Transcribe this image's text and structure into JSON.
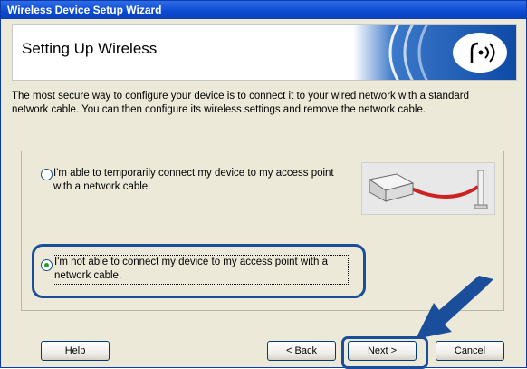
{
  "window": {
    "title": "Wireless Device Setup Wizard"
  },
  "header": {
    "title": "Setting Up Wireless",
    "logo_icon": "wireless-signal-icon"
  },
  "description": "The most secure way to configure your device is to connect it to your wired network with a standard network cable. You can then configure its wireless settings and remove the network cable.",
  "options": [
    {
      "label": "I'm able to temporarily connect my device to my access point with a network cable.",
      "selected": false
    },
    {
      "label": "I'm not able to connect my device to my access point with a network cable.",
      "selected": true
    }
  ],
  "illustration_icon": "printer-cable-accesspoint-icon",
  "buttons": {
    "help": "Help",
    "back": "< Back",
    "next": "Next >",
    "cancel": "Cancel"
  },
  "colors": {
    "titlebar": "#0a4ad0",
    "highlight": "#1a4e9a",
    "radio_dot": "#21a121",
    "cable": "#cc2222"
  }
}
